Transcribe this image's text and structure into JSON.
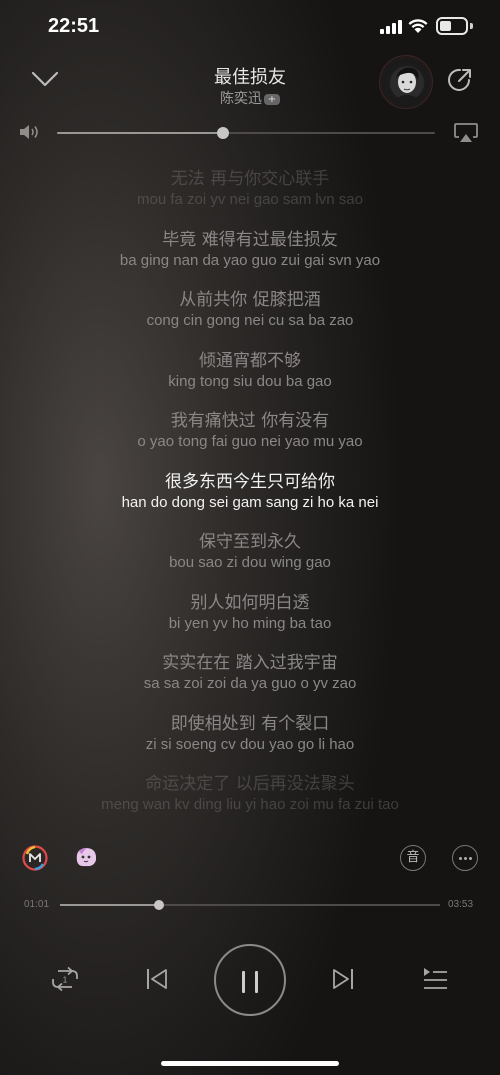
{
  "status_bar": {
    "time": "22:51",
    "battery_level": 0.45
  },
  "header": {
    "song_title": "最佳损友",
    "artist": "陈奕迅",
    "artist_badge": "+",
    "icons": {
      "collapse": "chevron-down-icon",
      "share": "share-icon",
      "avatar": "artist-avatar"
    }
  },
  "volume": {
    "level": 0.44
  },
  "lyrics": [
    {
      "cn": "无法 再与你交心联手",
      "py": "mou fa zoi yv nei gao sam lvn sao"
    },
    {
      "cn": "毕竟 难得有过最佳损友",
      "py": "ba ging nan da yao guo zui gai svn yao"
    },
    {
      "cn": "从前共你 促膝把酒",
      "py": "cong cin gong nei cu sa ba zao"
    },
    {
      "cn": "倾通宵都不够",
      "py": "king tong siu dou ba gao"
    },
    {
      "cn": "我有痛快过 你有没有",
      "py": "o yao tong fai guo nei yao mu yao"
    },
    {
      "cn": "很多东西今生只可给你",
      "py": "han do dong sei gam sang zi ho ka nei"
    },
    {
      "cn": "保守至到永久",
      "py": "bou sao zi dou wing gao"
    },
    {
      "cn": "别人如何明白透",
      "py": "bi yen yv ho ming ba tao"
    },
    {
      "cn": "实实在在 踏入过我宇宙",
      "py": "sa sa zoi zoi da ya guo o yv zao"
    },
    {
      "cn": "即使相处到 有个裂口",
      "py": "zi si soeng cv dou yao go li hao"
    },
    {
      "cn": "命运决定了 以后再没法聚头",
      "py": "meng wan kv ding liu yi hao zoi mu fa zui tao"
    }
  ],
  "active_lyric_index": 5,
  "actions": {
    "sound_label": "音"
  },
  "playback": {
    "current_time": "01:01",
    "total_time": "03:53",
    "progress": 0.26
  },
  "controls": {
    "icons": [
      "repeat-one-icon",
      "previous-icon",
      "pause-icon",
      "next-icon",
      "playlist-icon"
    ]
  },
  "colors": {
    "lyric_active": "#f2f2f2",
    "lyric_inactive": "#8a8786"
  }
}
